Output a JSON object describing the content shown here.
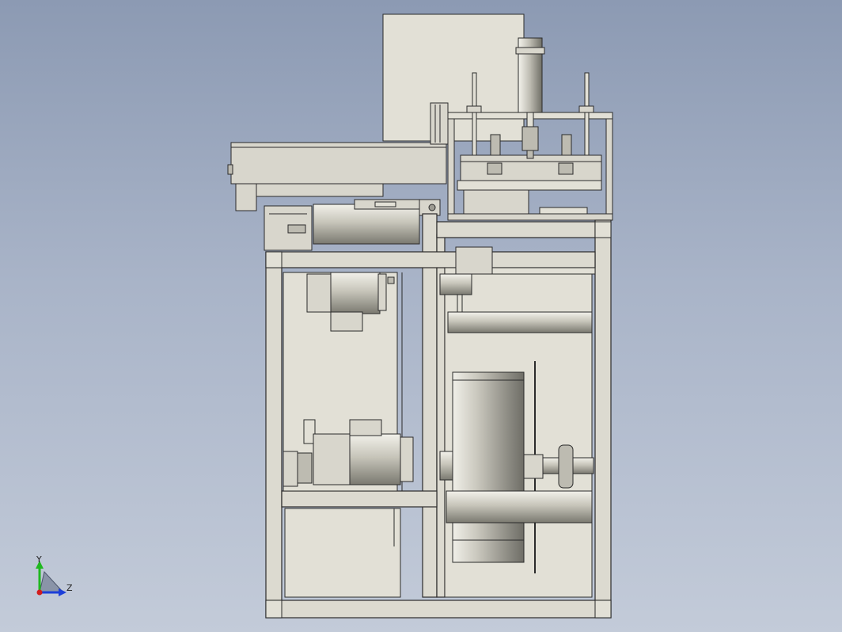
{
  "view": {
    "background_top": "#8c9ab3",
    "background_bottom": "#c3cbd9",
    "part_color": "#d8d6cc",
    "edge_color": "#2b2b2b"
  },
  "triad": {
    "y_label": "Y",
    "z_label": "Z",
    "y_color": "#1fb81f",
    "z_color": "#1c3fd8",
    "x_color": "#d21c1c"
  }
}
